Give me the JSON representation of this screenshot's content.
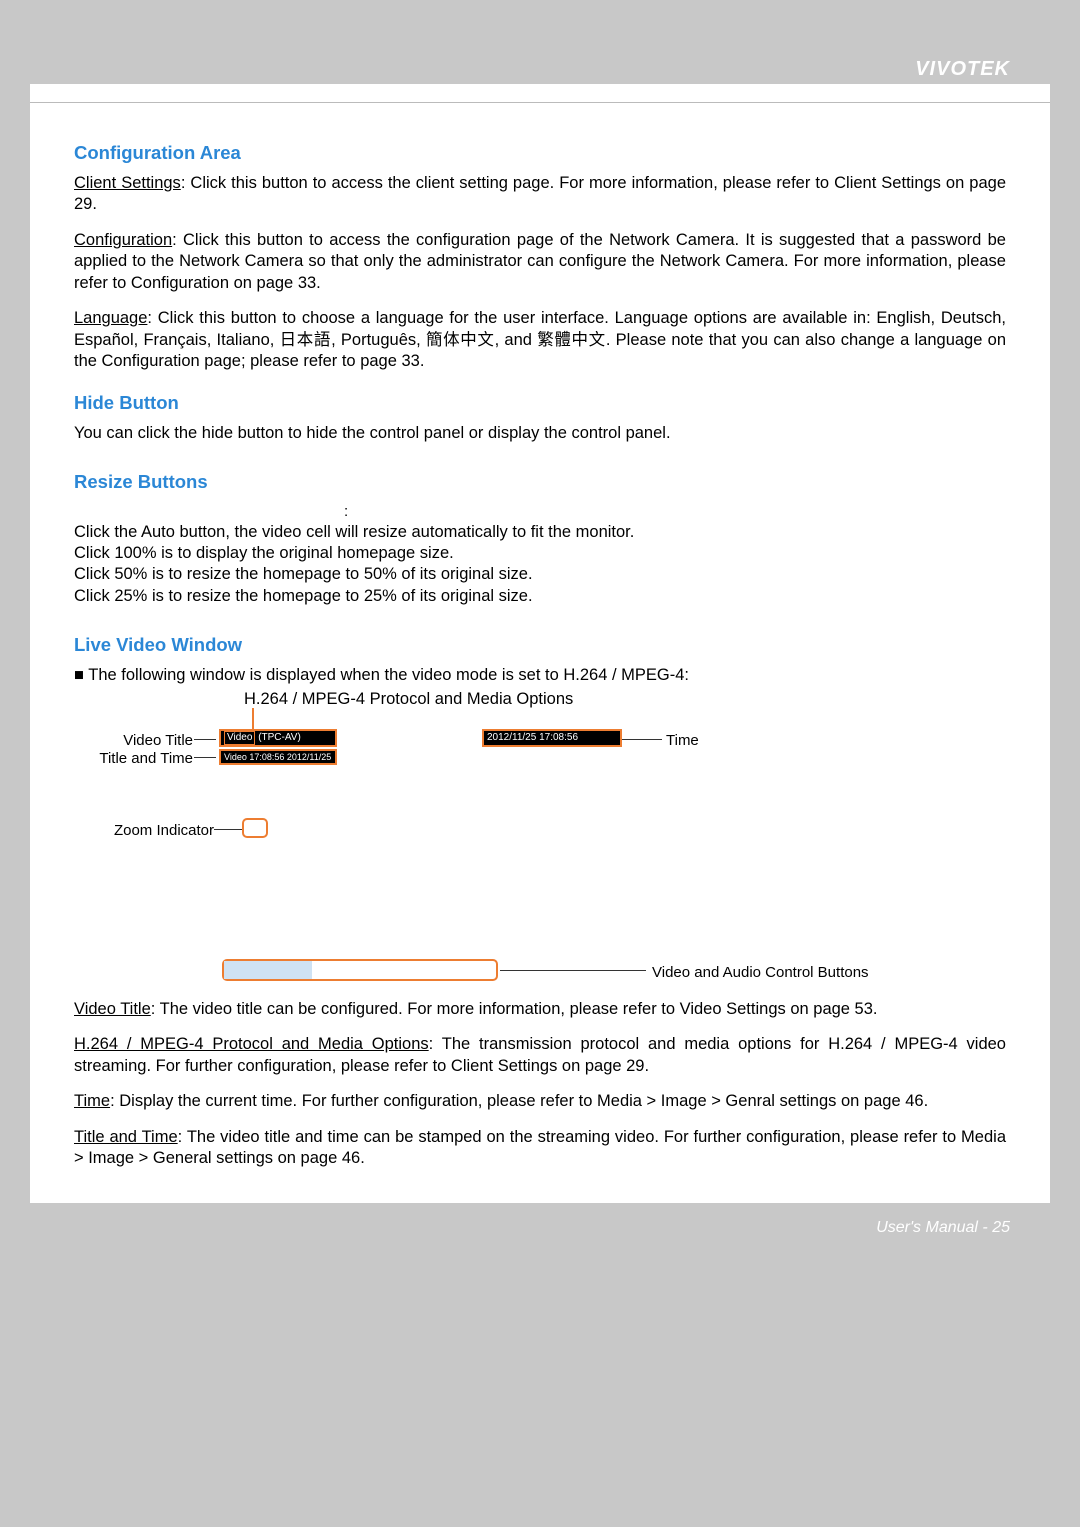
{
  "brand": "VIVOTEK",
  "footer": "User's Manual - 25",
  "sections": {
    "config_area": {
      "heading": "Configuration Area",
      "client_settings_u": "Client Settings",
      "client_settings_rest": ": Click this button to access the client setting page. For more information, please refer to Client Settings on page 29.",
      "configuration_u": "Configuration",
      "configuration_rest": ": Click this button to access the configuration page of the Network Camera. It is suggested that a password be applied to the Network Camera so that only the administrator can configure the Network Camera. For more information, please refer to Configuration on page 33.",
      "language_u": "Language",
      "language_rest": ": Click this button to choose a language for the user interface. Language options are available in: English, Deutsch, Español, Français, Italiano, 日本語, Português, 簡体中文, and 繁體中文.  Please note that you can also change a language on the Configuration page; please refer to page 33."
    },
    "hide_button": {
      "heading": "Hide Button",
      "text": "You can click the hide button to hide the control panel or display the control panel."
    },
    "resize_buttons": {
      "heading": "Resize Buttons",
      "colon": ":",
      "line1": "Click the Auto button, the video cell will resize automatically to fit the monitor.",
      "line2": "Click 100% is to display the original homepage size.",
      "line3": "Click 50% is to resize the homepage to 50% of its original size.",
      "line4": "Click 25% is to resize the homepage to 25% of its original size."
    },
    "live_video": {
      "heading": "Live Video Window",
      "intro": "■ The following window is displayed when the video mode is set to H.264 / MPEG-4:",
      "protocol_label": "H.264 / MPEG-4 Protocol and Media Options",
      "callouts": {
        "video_title": "Video Title",
        "title_and_time": "Title and Time",
        "time": "Time",
        "zoom_indicator": "Zoom Indicator",
        "av_control": "Video and Audio Control Buttons"
      },
      "overlay": {
        "video_inner": "Video",
        "video_title_text": "(TPC-AV)",
        "title_time_text": "Video 17:08:56  2012/11/25",
        "time_text": "2012/11/25  17:08:56"
      },
      "video_title_u": "Video Title",
      "video_title_rest": ": The video title can be configured. For more information, please refer to Video Settings on page 53.",
      "proto_u": "H.264 / MPEG-4 Protocol and Media Options",
      "proto_rest": ": The transmission protocol and media options for H.264 / MPEG-4 video streaming. For further configuration, please refer to Client Settings on page 29.",
      "time_u": "Time",
      "time_rest": ": Display the current time. For further configuration, please refer to Media > Image > Genral settings on page 46.",
      "tt_u": "Title and Time",
      "tt_rest": ": The video title and time can be stamped on the streaming video. For further configuration, please refer to Media > Image > General settings on page 46."
    }
  }
}
